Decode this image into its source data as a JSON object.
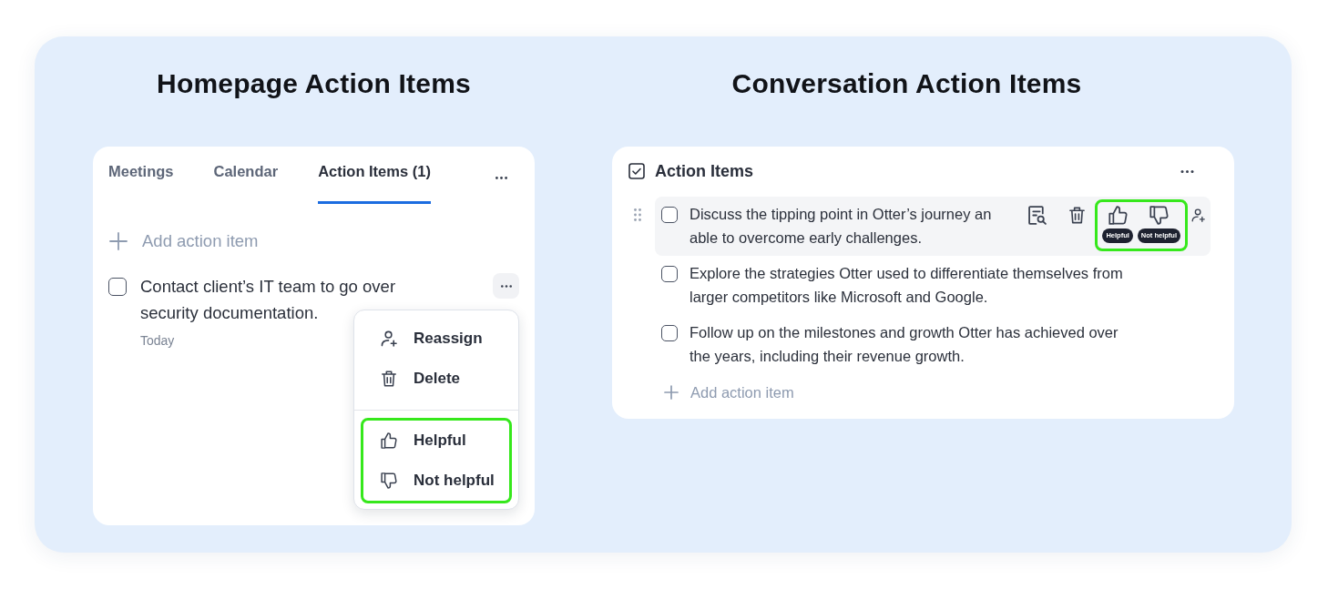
{
  "homepage": {
    "heading": "Homepage Action Items",
    "tabs": [
      {
        "label": "Meetings",
        "selected": false
      },
      {
        "label": "Calendar",
        "selected": false
      },
      {
        "label": "Action Items (1)",
        "selected": true
      }
    ],
    "add_item": {
      "label": "Add action item"
    },
    "items": [
      {
        "checked": false,
        "lines": [
          "Contact client’s IT team to go over",
          "security documentation."
        ],
        "due": "Today",
        "menu": {
          "groups": [
            {
              "highlighted": false,
              "items": [
                {
                  "kind": "reassign",
                  "label": "Reassign"
                },
                {
                  "kind": "delete",
                  "label": "Delete"
                }
              ]
            },
            {
              "highlighted": true,
              "items": [
                {
                  "kind": "like",
                  "label": "Helpful"
                },
                {
                  "kind": "dislike",
                  "label": "Not helpful"
                }
              ]
            }
          ]
        }
      }
    ]
  },
  "conversation": {
    "heading": "Conversation Action Items",
    "title": "Action Items",
    "items": [
      {
        "checked": false,
        "hovered": true,
        "lines": [
          "Discuss the tipping point in Otter’s journey an",
          "able to overcome early challenges."
        ]
      },
      {
        "checked": false,
        "hovered": false,
        "lines": [
          "Explore the strategies Otter used to differentiate themselves from",
          "larger competitors like Microsoft and Google."
        ]
      },
      {
        "checked": false,
        "hovered": false,
        "lines": [
          "Follow up on the milestones and growth Otter has achieved over",
          "the years, including their revenue growth."
        ]
      }
    ],
    "row_toolbar": {
      "feedback_highlighted": true,
      "feedback": [
        {
          "kind": "like",
          "tooltip": "Helpful"
        },
        {
          "kind": "dislike",
          "tooltip": "Not helpful"
        }
      ]
    },
    "add_item": {
      "label": "Add action item"
    }
  }
}
